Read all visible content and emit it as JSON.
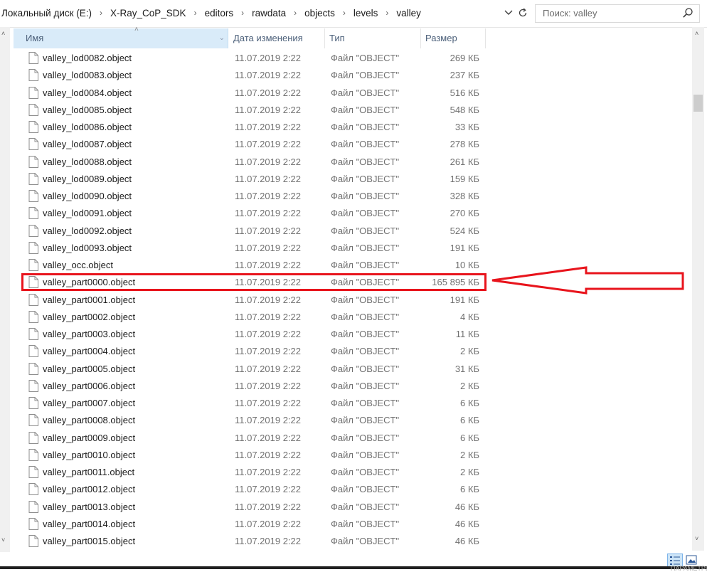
{
  "address": {
    "breadcrumb": [
      "Локальный диск (E:)",
      "X-Ray_CoP_SDK",
      "editors",
      "rawdata",
      "objects",
      "levels",
      "valley"
    ]
  },
  "search": {
    "placeholder": "Поиск: valley"
  },
  "columns": {
    "name": "Имя",
    "date": "Дата изменения",
    "type": "Тип",
    "size": "Размер"
  },
  "files": [
    {
      "name": "valley_lod0082.object",
      "date": "11.07.2019 2:22",
      "type": "Файл \"OBJECT\"",
      "size": "269 КБ"
    },
    {
      "name": "valley_lod0083.object",
      "date": "11.07.2019 2:22",
      "type": "Файл \"OBJECT\"",
      "size": "237 КБ"
    },
    {
      "name": "valley_lod0084.object",
      "date": "11.07.2019 2:22",
      "type": "Файл \"OBJECT\"",
      "size": "516 КБ"
    },
    {
      "name": "valley_lod0085.object",
      "date": "11.07.2019 2:22",
      "type": "Файл \"OBJECT\"",
      "size": "548 КБ"
    },
    {
      "name": "valley_lod0086.object",
      "date": "11.07.2019 2:22",
      "type": "Файл \"OBJECT\"",
      "size": "33 КБ"
    },
    {
      "name": "valley_lod0087.object",
      "date": "11.07.2019 2:22",
      "type": "Файл \"OBJECT\"",
      "size": "278 КБ"
    },
    {
      "name": "valley_lod0088.object",
      "date": "11.07.2019 2:22",
      "type": "Файл \"OBJECT\"",
      "size": "261 КБ"
    },
    {
      "name": "valley_lod0089.object",
      "date": "11.07.2019 2:22",
      "type": "Файл \"OBJECT\"",
      "size": "159 КБ"
    },
    {
      "name": "valley_lod0090.object",
      "date": "11.07.2019 2:22",
      "type": "Файл \"OBJECT\"",
      "size": "328 КБ"
    },
    {
      "name": "valley_lod0091.object",
      "date": "11.07.2019 2:22",
      "type": "Файл \"OBJECT\"",
      "size": "270 КБ"
    },
    {
      "name": "valley_lod0092.object",
      "date": "11.07.2019 2:22",
      "type": "Файл \"OBJECT\"",
      "size": "524 КБ"
    },
    {
      "name": "valley_lod0093.object",
      "date": "11.07.2019 2:22",
      "type": "Файл \"OBJECT\"",
      "size": "191 КБ"
    },
    {
      "name": "valley_occ.object",
      "date": "11.07.2019 2:22",
      "type": "Файл \"OBJECT\"",
      "size": "10 КБ"
    },
    {
      "name": "valley_part0000.object",
      "date": "11.07.2019 2:22",
      "type": "Файл \"OBJECT\"",
      "size": "165 895 КБ"
    },
    {
      "name": "valley_part0001.object",
      "date": "11.07.2019 2:22",
      "type": "Файл \"OBJECT\"",
      "size": "191 КБ"
    },
    {
      "name": "valley_part0002.object",
      "date": "11.07.2019 2:22",
      "type": "Файл \"OBJECT\"",
      "size": "4 КБ"
    },
    {
      "name": "valley_part0003.object",
      "date": "11.07.2019 2:22",
      "type": "Файл \"OBJECT\"",
      "size": "11 КБ"
    },
    {
      "name": "valley_part0004.object",
      "date": "11.07.2019 2:22",
      "type": "Файл \"OBJECT\"",
      "size": "2 КБ"
    },
    {
      "name": "valley_part0005.object",
      "date": "11.07.2019 2:22",
      "type": "Файл \"OBJECT\"",
      "size": "31 КБ"
    },
    {
      "name": "valley_part0006.object",
      "date": "11.07.2019 2:22",
      "type": "Файл \"OBJECT\"",
      "size": "2 КБ"
    },
    {
      "name": "valley_part0007.object",
      "date": "11.07.2019 2:22",
      "type": "Файл \"OBJECT\"",
      "size": "6 КБ"
    },
    {
      "name": "valley_part0008.object",
      "date": "11.07.2019 2:22",
      "type": "Файл \"OBJECT\"",
      "size": "6 КБ"
    },
    {
      "name": "valley_part0009.object",
      "date": "11.07.2019 2:22",
      "type": "Файл \"OBJECT\"",
      "size": "6 КБ"
    },
    {
      "name": "valley_part0010.object",
      "date": "11.07.2019 2:22",
      "type": "Файл \"OBJECT\"",
      "size": "2 КБ"
    },
    {
      "name": "valley_part0011.object",
      "date": "11.07.2019 2:22",
      "type": "Файл \"OBJECT\"",
      "size": "2 КБ"
    },
    {
      "name": "valley_part0012.object",
      "date": "11.07.2019 2:22",
      "type": "Файл \"OBJECT\"",
      "size": "6 КБ"
    },
    {
      "name": "valley_part0013.object",
      "date": "11.07.2019 2:22",
      "type": "Файл \"OBJECT\"",
      "size": "46 КБ"
    },
    {
      "name": "valley_part0014.object",
      "date": "11.07.2019 2:22",
      "type": "Файл \"OBJECT\"",
      "size": "46 КБ"
    },
    {
      "name": "valley_part0015.object",
      "date": "11.07.2019 2:22",
      "type": "Файл \"OBJECT\"",
      "size": "46 КБ"
    }
  ],
  "highlighted_file_index": 13,
  "annotation": {
    "color": "#e8141c",
    "shape": "rectangle-and-arrow"
  },
  "colors": {
    "selected_header": "#d9ebf9",
    "header_text": "#4c607a",
    "meta_text": "#707070"
  },
  "icons": [
    "search-icon",
    "refresh-icon",
    "chevron-down-icon",
    "file-icon",
    "details-view-icon",
    "tiles-view-icon"
  ],
  "status_corner_text": "ПАРАМЕТРЫ"
}
